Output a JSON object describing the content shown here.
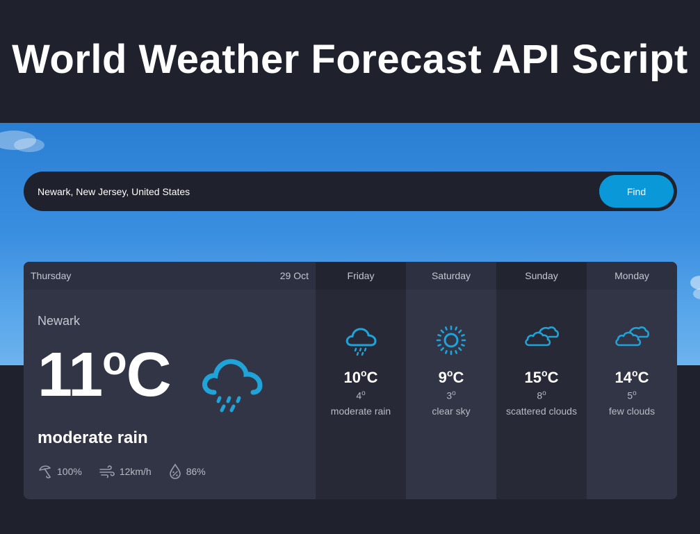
{
  "page": {
    "title": "World Weather Forecast API Script"
  },
  "search": {
    "value": "Newark, New Jersey, United States",
    "button_label": "Find"
  },
  "today": {
    "day": "Thursday",
    "date": "29 Oct",
    "location": "Newark",
    "temp": "11",
    "degree": "o",
    "unit": "C",
    "description": "moderate rain",
    "icon": "rain-cloud-icon",
    "stats": {
      "precipitation": "100%",
      "wind": "12km/h",
      "humidity": "86%"
    }
  },
  "forecast": [
    {
      "day": "Friday",
      "temp": "10",
      "low": "4",
      "description": "moderate rain",
      "icon": "rain-cloud-icon"
    },
    {
      "day": "Saturday",
      "temp": "9",
      "low": "3",
      "description": "clear sky",
      "icon": "sun-icon"
    },
    {
      "day": "Sunday",
      "temp": "15",
      "low": "8",
      "description": "scattered clouds",
      "icon": "clouds-icon"
    },
    {
      "day": "Monday",
      "temp": "14",
      "low": "5",
      "description": "few clouds",
      "icon": "clouds-icon"
    }
  ],
  "colors": {
    "accent": "#0b98d8",
    "icon": "#1fa3d8",
    "background": "#1f212d",
    "panel": "#323546",
    "panel_dark": "#272a36"
  }
}
